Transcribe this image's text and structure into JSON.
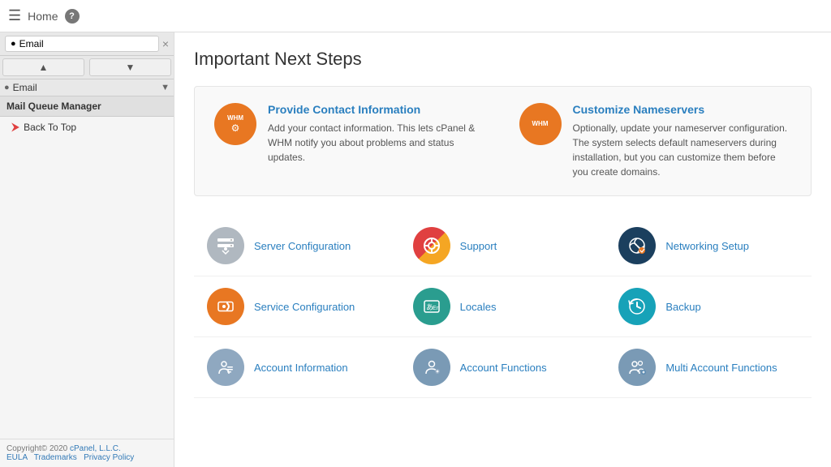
{
  "topbar": {
    "home_label": "Home",
    "help_label": "?"
  },
  "sidebar": {
    "tab_label": "Email",
    "close_label": "×",
    "nav_up": "▲",
    "nav_down": "▼",
    "search_placeholder": "Email",
    "items": [
      {
        "id": "mail-queue-manager",
        "label": "Mail Queue Manager"
      },
      {
        "id": "back-to-top",
        "label": "Back To Top"
      }
    ],
    "footer": {
      "copyright": "Copyright© 2020 ",
      "cpanel_link": "cPanel, L.L.C.",
      "eula": "EULA",
      "trademarks": "Trademarks",
      "privacy": "Privacy Policy"
    }
  },
  "main": {
    "page_title": "Important Next Steps",
    "next_steps": [
      {
        "id": "provide-contact",
        "icon_text": "WHM",
        "title": "Provide Contact Information",
        "description": "Add your contact information. This lets cPanel & WHM notify you about problems and status updates."
      },
      {
        "id": "customize-nameservers",
        "icon_text": "WHM",
        "title": "Customize Nameservers",
        "description": "Optionally, update your nameserver configuration. The system selects default nameservers during installation, but you can customize them before you create domains."
      }
    ],
    "features": [
      {
        "id": "server-configuration",
        "label": "Server Configuration",
        "icon_type": "server",
        "color": "gray"
      },
      {
        "id": "support",
        "label": "Support",
        "icon_type": "lifebuoy",
        "color": "red-orange"
      },
      {
        "id": "networking-setup",
        "label": "Networking Setup",
        "icon_type": "network",
        "color": "dark-blue"
      },
      {
        "id": "service-configuration",
        "label": "Service Configuration",
        "icon_type": "wrench",
        "color": "orange"
      },
      {
        "id": "locales",
        "label": "Locales",
        "icon_type": "locales",
        "color": "teal"
      },
      {
        "id": "backup",
        "label": "Backup",
        "icon_type": "backup",
        "color": "cyan"
      },
      {
        "id": "account-information",
        "label": "Account Information",
        "icon_type": "account-info",
        "color": "light-gray"
      },
      {
        "id": "account-functions",
        "label": "Account Functions",
        "icon_type": "account-func",
        "color": "blue-gray"
      },
      {
        "id": "multi-account-functions",
        "label": "Multi Account Functions",
        "icon_type": "multi-account",
        "color": "blue-gray"
      }
    ]
  }
}
